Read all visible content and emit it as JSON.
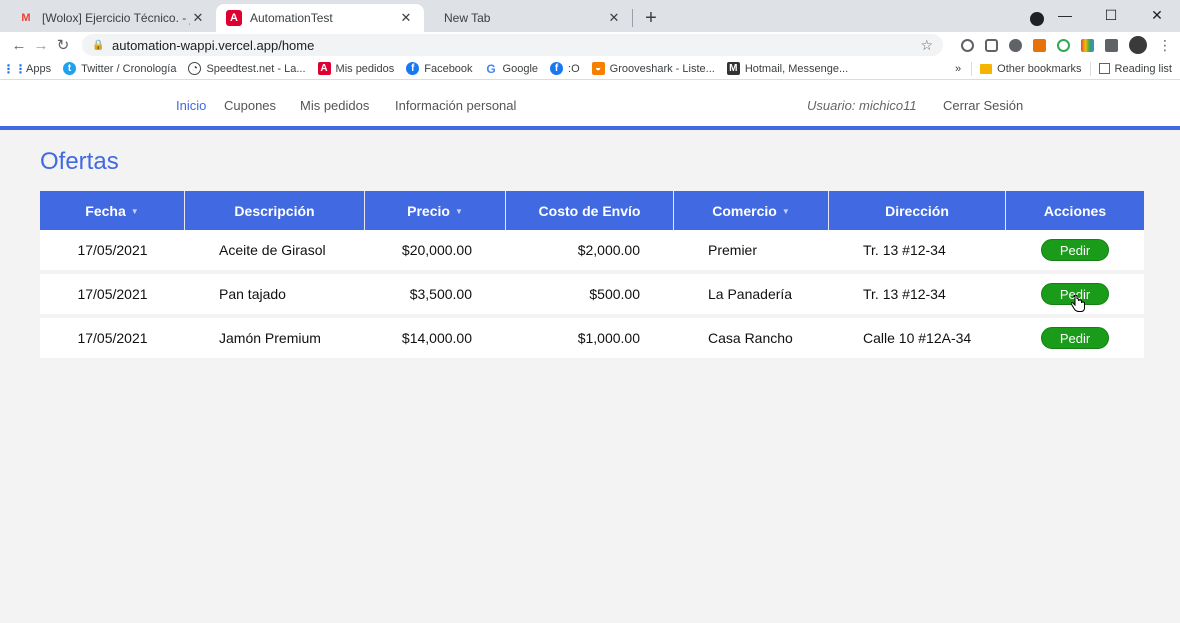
{
  "browser": {
    "tabs": [
      {
        "title": "[Wolox] Ejercicio Técnico. - johnd",
        "favicon": "gmail-icon",
        "active": false
      },
      {
        "title": "AutomationTest",
        "favicon": "angular-icon",
        "active": true
      },
      {
        "title": "New Tab",
        "favicon": "",
        "active": false
      }
    ],
    "new_tab_symbol": "+",
    "window_controls": {
      "minimize": "—",
      "maximize": "☐",
      "close": "✕"
    },
    "address": "automation-wappi.vercel.app/home",
    "bookmarks": [
      {
        "label": "Apps",
        "icon": "apps-grid-icon",
        "color": "#1a73e8"
      },
      {
        "label": "Twitter / Cronología",
        "icon": "twitter-icon",
        "color": "#1da1f2"
      },
      {
        "label": "Speedtest.net - La...",
        "icon": "speedtest-icon",
        "color": "#444444"
      },
      {
        "label": "Mis pedidos",
        "icon": "angular-icon",
        "color": "#dd0031"
      },
      {
        "label": "Facebook",
        "icon": "facebook-icon",
        "color": "#1877f2"
      },
      {
        "label": "Google",
        "icon": "google-icon",
        "color": "#4285f4"
      },
      {
        "label": ":O",
        "icon": "facebook-icon",
        "color": "#1877f2"
      },
      {
        "label": "Grooveshark - Liste...",
        "icon": "grooveshark-icon",
        "color": "#f77f00"
      },
      {
        "label": "Hotmail, Messenge...",
        "icon": "msn-icon",
        "color": "#333333"
      }
    ],
    "bookmarks_overflow": "»",
    "other_bookmarks": "Other bookmarks",
    "reading_list": "Reading list"
  },
  "nav": {
    "links": [
      "Inicio",
      "Cupones",
      "Mis pedidos",
      "Información personal"
    ],
    "active": "Inicio",
    "user": "Usuario: michico11",
    "logout": "Cerrar Sesión"
  },
  "offers": {
    "title": "Ofertas",
    "columns": [
      {
        "label": "Fecha",
        "sortable": true
      },
      {
        "label": "Descripción",
        "sortable": false
      },
      {
        "label": "Precio",
        "sortable": true
      },
      {
        "label": "Costo de Envío",
        "sortable": false
      },
      {
        "label": "Comercio",
        "sortable": true
      },
      {
        "label": "Dirección",
        "sortable": false
      },
      {
        "label": "Acciones",
        "sortable": false
      }
    ],
    "rows": [
      {
        "fecha": "17/05/2021",
        "descripcion": "Aceite de Girasol",
        "precio": "$20,000.00",
        "envio": "$2,000.00",
        "comercio": "Premier",
        "direccion": "Tr. 13 #12-34",
        "accion": "Pedir"
      },
      {
        "fecha": "17/05/2021",
        "descripcion": "Pan tajado",
        "precio": "$3,500.00",
        "envio": "$500.00",
        "comercio": "La Panadería",
        "direccion": "Tr. 13 #12-34",
        "accion": "Pedir"
      },
      {
        "fecha": "17/05/2021",
        "descripcion": "Jamón Premium",
        "precio": "$14,000.00",
        "envio": "$1,000.00",
        "comercio": "Casa Rancho",
        "direccion": "Calle 10 #12A-34",
        "accion": "Pedir"
      }
    ]
  },
  "colors": {
    "accent": "#4169e1",
    "button_green": "#1a9b1a",
    "page_bg": "#f3f3f3"
  }
}
